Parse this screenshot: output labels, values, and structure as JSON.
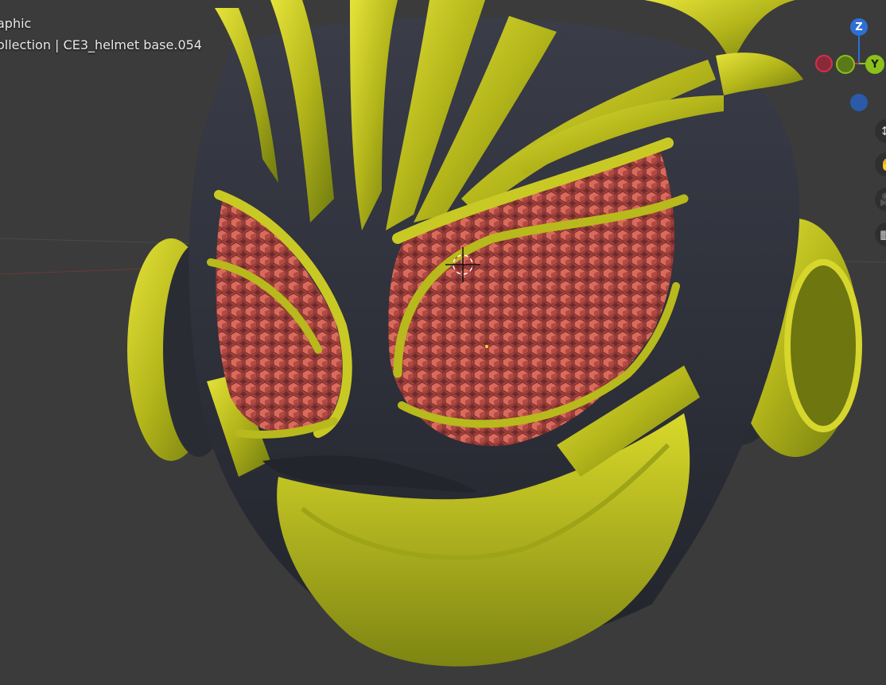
{
  "viewport": {
    "shading_mode_partial": "aphic",
    "collection_line_partial": "ollection | CE3_helmet base.054"
  },
  "gizmo": {
    "z_label": "Z",
    "y_label": "Y",
    "colors": {
      "z": "#2d6fd6",
      "y": "#8bc11c",
      "x": "#d6304a"
    }
  },
  "nav_buttons": [
    {
      "icon": "zoom-icon"
    },
    {
      "icon": "pan-hand-icon"
    },
    {
      "icon": "camera-icon"
    },
    {
      "icon": "grid-icon"
    }
  ],
  "model": {
    "object_name": "CE3_helmet base.054",
    "colors": {
      "gold": "#b5b81a",
      "dark": "#2e3038",
      "red": "#c9594f"
    }
  }
}
